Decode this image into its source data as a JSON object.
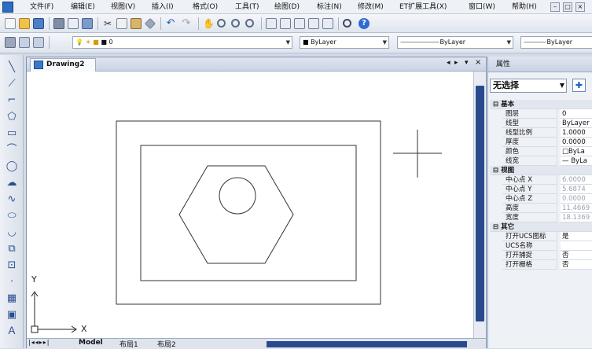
{
  "menu": [
    "文件(F)",
    "编辑(E)",
    "视图(V)",
    "插入(I)",
    "格式(O)",
    "工具(T)",
    "绘图(D)",
    "标注(N)",
    "修改(M)",
    "ET扩展工具(X)",
    "窗口(W)",
    "帮助(H)"
  ],
  "window_controls": [
    "–",
    "□",
    "×"
  ],
  "layer_combo": "0",
  "color_combo": "ByLayer",
  "linetype_combo": "ByLayer",
  "lineweight_combo": "ByLayer",
  "document_tab": "Drawing2",
  "axis": {
    "y": "Y",
    "x": "X"
  },
  "layout_tabs": [
    "Model",
    "布局1",
    "布局2"
  ],
  "properties": {
    "title": "属性",
    "selection": "无选择",
    "categories": [
      {
        "name": "基本",
        "rows": [
          {
            "key": "图层",
            "value": "0"
          },
          {
            "key": "线型",
            "value": "ByLayer"
          },
          {
            "key": "线型比例",
            "value": "1.0000"
          },
          {
            "key": "厚度",
            "value": "0.0000"
          },
          {
            "key": "颜色",
            "value": "□ByLa"
          },
          {
            "key": "线宽",
            "value": "— ByLa"
          }
        ]
      },
      {
        "name": "视图",
        "rows": [
          {
            "key": "中心点 X",
            "value": "6.0000"
          },
          {
            "key": "中心点 Y",
            "value": "5.6874"
          },
          {
            "key": "中心点 Z",
            "value": "0.0000"
          },
          {
            "key": "高度",
            "value": "11.4669"
          },
          {
            "key": "宽度",
            "value": "18.1369"
          }
        ]
      },
      {
        "name": "其它",
        "rows": [
          {
            "key": "打开UCS图标",
            "value": "是"
          },
          {
            "key": "UCS名称",
            "value": ""
          },
          {
            "key": "打开捕捉",
            "value": "否"
          },
          {
            "key": "打开栅格",
            "value": "否"
          }
        ]
      }
    ]
  },
  "tab_nav_icons": [
    "◂",
    "▸",
    "▾",
    "×"
  ]
}
